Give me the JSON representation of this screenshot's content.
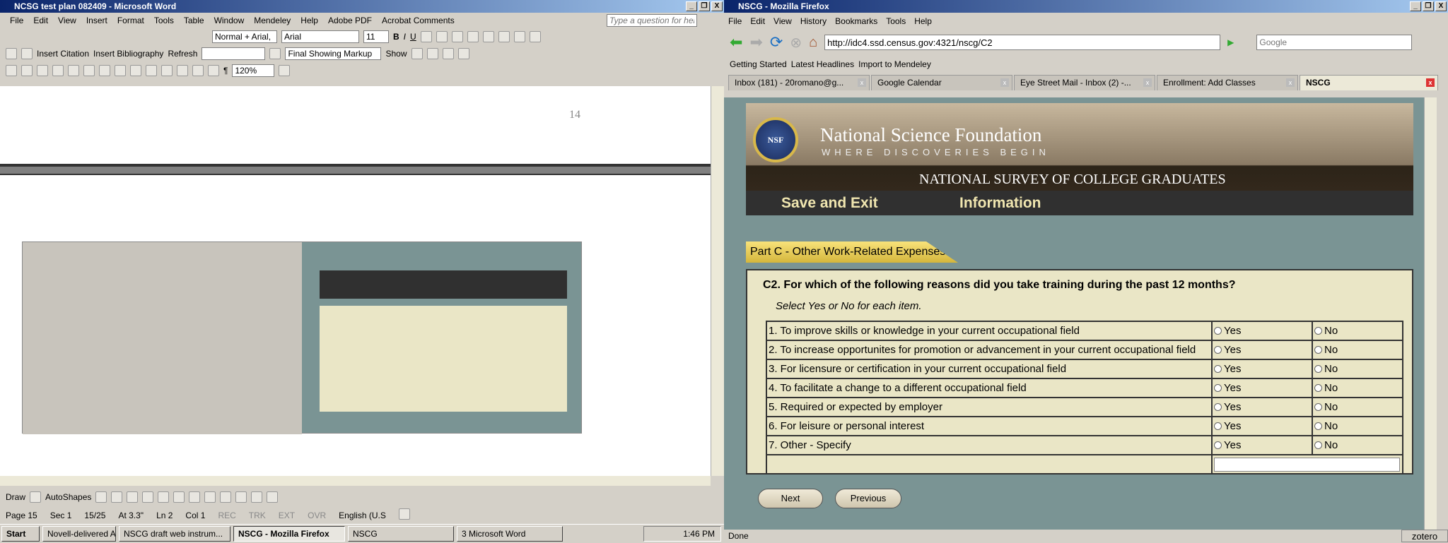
{
  "word": {
    "title": "NCSG test plan 082409 - Microsoft Word",
    "menu": [
      "File",
      "Edit",
      "View",
      "Insert",
      "Format",
      "Tools",
      "Table",
      "Window",
      "Mendeley",
      "Help",
      "Adobe PDF",
      "Acrobat Comments"
    ],
    "help_placeholder": "Type a question for help",
    "style": "Normal + Arial,",
    "font": "Arial",
    "size": "11",
    "insert_citation": "Insert Citation",
    "insert_bibliography": "Insert Bibliography",
    "refresh": "Refresh",
    "markup": "Final Showing Markup",
    "show": "Show",
    "zoom": "120%",
    "page_number": "14",
    "draw": "Draw",
    "autoshapes": "AutoShapes",
    "status": [
      "Page 15",
      "Sec 1",
      "15/25",
      "At 3.3\"",
      "Ln 2",
      "Col 1",
      "REC",
      "TRK",
      "EXT",
      "OVR",
      "English (U.S"
    ]
  },
  "taskbar": {
    "start": "Start",
    "tasks": [
      "Novell-delivered Applica...",
      "NSCG draft web instrum...",
      "NSCG - Mozilla Firefox",
      "NSCG",
      "3 Microsoft Word"
    ],
    "clock": "1:46 PM"
  },
  "firefox": {
    "title": "NSCG - Mozilla Firefox",
    "menu": [
      "File",
      "Edit",
      "View",
      "History",
      "Bookmarks",
      "Tools",
      "Help"
    ],
    "url": "http://idc4.ssd.census.gov:4321/nscg/C2",
    "search_placeholder": "Google",
    "bookmarks": [
      "Getting Started",
      "Latest Headlines",
      "Import to Mendeley"
    ],
    "tabs": [
      "Inbox (181) - 20romano@g...",
      "Google Calendar",
      "Eye Street Mail - Inbox (2) -...",
      "Enrollment: Add Classes",
      "NSCG"
    ],
    "status": "Done",
    "zotero": "zotero"
  },
  "page": {
    "org": "National Science Foundation",
    "tagline": "WHERE DISCOVERIES BEGIN",
    "logo": "NSF",
    "survey": "NATIONAL SURVEY OF COLLEGE GRADUATES",
    "nav": [
      "Save and Exit",
      "Information"
    ],
    "part": "Part C - Other Work-Related Expenses",
    "question": "C2. For which of the following reasons did you take training during the past 12 months?",
    "instruction": "Select Yes or No for each item.",
    "yes": "Yes",
    "no": "No",
    "items": [
      "1. To improve skills or knowledge in your current occupational field",
      "2. To increase opportunites for promotion or advancement in your current occupational field",
      "3. For licensure or certification in your current occupational field",
      "4. To facilitate a change to a different occupational field",
      "5. Required or expected by employer",
      "6. For leisure or personal interest",
      "7. Other - Specify"
    ],
    "specify_value": "",
    "next": "Next",
    "previous": "Previous"
  }
}
